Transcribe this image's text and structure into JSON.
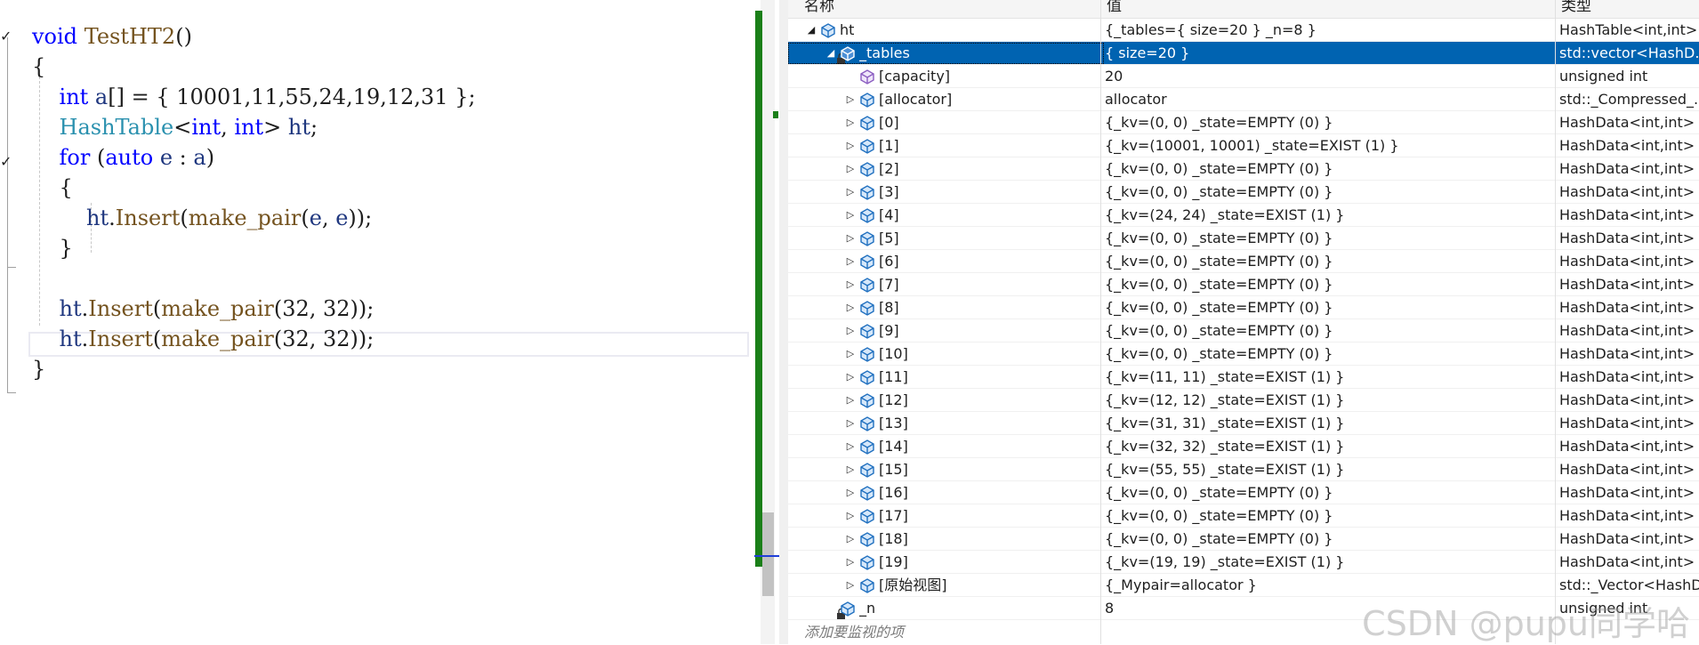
{
  "editor": {
    "lines": [
      {
        "tokens": [
          {
            "t": "void ",
            "c": "kw"
          },
          {
            "t": "TestHT2",
            "c": "fn"
          },
          {
            "t": "()",
            "c": "pl"
          }
        ]
      },
      {
        "tokens": [
          {
            "t": "{",
            "c": "pl"
          }
        ]
      },
      {
        "tokens": [
          {
            "t": "    int ",
            "c": "kw"
          },
          {
            "t": "a",
            "c": "id"
          },
          {
            "t": "[] = { 10001,11,55,24,19,12,31 };",
            "c": "pl"
          }
        ]
      },
      {
        "tokens": [
          {
            "t": "    HashTable",
            "c": "ty"
          },
          {
            "t": "<",
            "c": "pl"
          },
          {
            "t": "int",
            "c": "kw"
          },
          {
            "t": ", ",
            "c": "pl"
          },
          {
            "t": "int",
            "c": "kw"
          },
          {
            "t": "> ",
            "c": "pl"
          },
          {
            "t": "ht",
            "c": "id"
          },
          {
            "t": ";",
            "c": "pl"
          }
        ]
      },
      {
        "tokens": [
          {
            "t": "    for ",
            "c": "kw"
          },
          {
            "t": "(",
            "c": "pl"
          },
          {
            "t": "auto ",
            "c": "kw"
          },
          {
            "t": "e",
            "c": "id"
          },
          {
            "t": " : ",
            "c": "pl"
          },
          {
            "t": "a",
            "c": "id"
          },
          {
            "t": ")",
            "c": "pl"
          }
        ]
      },
      {
        "tokens": [
          {
            "t": "    {",
            "c": "pl"
          }
        ]
      },
      {
        "tokens": [
          {
            "t": "        ht",
            "c": "id"
          },
          {
            "t": ".",
            "c": "pl"
          },
          {
            "t": "Insert",
            "c": "fn"
          },
          {
            "t": "(",
            "c": "pl"
          },
          {
            "t": "make_pair",
            "c": "fn"
          },
          {
            "t": "(",
            "c": "pl"
          },
          {
            "t": "e",
            "c": "id"
          },
          {
            "t": ", ",
            "c": "pl"
          },
          {
            "t": "e",
            "c": "id"
          },
          {
            "t": "));",
            "c": "pl"
          }
        ]
      },
      {
        "tokens": [
          {
            "t": "    }",
            "c": "pl"
          }
        ]
      },
      {
        "tokens": [
          {
            "t": "",
            "c": "pl"
          }
        ]
      },
      {
        "tokens": [
          {
            "t": "    ht",
            "c": "id"
          },
          {
            "t": ".",
            "c": "pl"
          },
          {
            "t": "Insert",
            "c": "fn"
          },
          {
            "t": "(",
            "c": "pl"
          },
          {
            "t": "make_pair",
            "c": "fn"
          },
          {
            "t": "(32, 32));",
            "c": "pl"
          }
        ]
      },
      {
        "tokens": [
          {
            "t": "    ht",
            "c": "id"
          },
          {
            "t": ".",
            "c": "pl"
          },
          {
            "t": "Insert",
            "c": "fn"
          },
          {
            "t": "(",
            "c": "pl"
          },
          {
            "t": "make_pair",
            "c": "fn"
          },
          {
            "t": "(32, 32));",
            "c": "pl"
          }
        ]
      },
      {
        "tokens": [
          {
            "t": "}",
            "c": "pl"
          }
        ]
      }
    ],
    "fold_marks": [
      "✓",
      "✓"
    ]
  },
  "watch": {
    "headers": {
      "name": "名称",
      "value": "值",
      "type": "类型"
    },
    "rows": [
      {
        "expander": "expanded",
        "icon": "object",
        "name": "ht",
        "value": "{_tables={ size=20 } _n=8 }",
        "type": "HashTable<int,int>"
      },
      {
        "expander": "expanded",
        "icon": "object",
        "lock": true,
        "name": "_tables",
        "value": "{ size=20 }",
        "type": "std::vector<HashD...",
        "selected": true
      },
      {
        "expander": "none",
        "icon": "field",
        "name": "[capacity]",
        "value": "20",
        "type": "unsigned int"
      },
      {
        "expander": "collapsed",
        "icon": "object",
        "name": "[allocator]",
        "value": "allocator",
        "type": "std::_Compressed_..."
      },
      {
        "expander": "collapsed",
        "icon": "object",
        "name": "[0]",
        "value": "{_kv=(0, 0) _state=EMPTY (0) }",
        "type": "HashData<int,int>"
      },
      {
        "expander": "collapsed",
        "icon": "object",
        "name": "[1]",
        "value": "{_kv=(10001, 10001) _state=EXIST (1) }",
        "type": "HashData<int,int>"
      },
      {
        "expander": "collapsed",
        "icon": "object",
        "name": "[2]",
        "value": "{_kv=(0, 0) _state=EMPTY (0) }",
        "type": "HashData<int,int>"
      },
      {
        "expander": "collapsed",
        "icon": "object",
        "name": "[3]",
        "value": "{_kv=(0, 0) _state=EMPTY (0) }",
        "type": "HashData<int,int>"
      },
      {
        "expander": "collapsed",
        "icon": "object",
        "name": "[4]",
        "value": "{_kv=(24, 24) _state=EXIST (1) }",
        "type": "HashData<int,int>"
      },
      {
        "expander": "collapsed",
        "icon": "object",
        "name": "[5]",
        "value": "{_kv=(0, 0) _state=EMPTY (0) }",
        "type": "HashData<int,int>"
      },
      {
        "expander": "collapsed",
        "icon": "object",
        "name": "[6]",
        "value": "{_kv=(0, 0) _state=EMPTY (0) }",
        "type": "HashData<int,int>"
      },
      {
        "expander": "collapsed",
        "icon": "object",
        "name": "[7]",
        "value": "{_kv=(0, 0) _state=EMPTY (0) }",
        "type": "HashData<int,int>"
      },
      {
        "expander": "collapsed",
        "icon": "object",
        "name": "[8]",
        "value": "{_kv=(0, 0) _state=EMPTY (0) }",
        "type": "HashData<int,int>"
      },
      {
        "expander": "collapsed",
        "icon": "object",
        "name": "[9]",
        "value": "{_kv=(0, 0) _state=EMPTY (0) }",
        "type": "HashData<int,int>"
      },
      {
        "expander": "collapsed",
        "icon": "object",
        "name": "[10]",
        "value": "{_kv=(0, 0) _state=EMPTY (0) }",
        "type": "HashData<int,int>"
      },
      {
        "expander": "collapsed",
        "icon": "object",
        "name": "[11]",
        "value": "{_kv=(11, 11) _state=EXIST (1) }",
        "type": "HashData<int,int>"
      },
      {
        "expander": "collapsed",
        "icon": "object",
        "name": "[12]",
        "value": "{_kv=(12, 12) _state=EXIST (1) }",
        "type": "HashData<int,int>"
      },
      {
        "expander": "collapsed",
        "icon": "object",
        "name": "[13]",
        "value": "{_kv=(31, 31) _state=EXIST (1) }",
        "type": "HashData<int,int>"
      },
      {
        "expander": "collapsed",
        "icon": "object",
        "name": "[14]",
        "value": "{_kv=(32, 32) _state=EXIST (1) }",
        "type": "HashData<int,int>"
      },
      {
        "expander": "collapsed",
        "icon": "object",
        "name": "[15]",
        "value": "{_kv=(55, 55) _state=EXIST (1) }",
        "type": "HashData<int,int>"
      },
      {
        "expander": "collapsed",
        "icon": "object",
        "name": "[16]",
        "value": "{_kv=(0, 0) _state=EMPTY (0) }",
        "type": "HashData<int,int>"
      },
      {
        "expander": "collapsed",
        "icon": "object",
        "name": "[17]",
        "value": "{_kv=(0, 0) _state=EMPTY (0) }",
        "type": "HashData<int,int>"
      },
      {
        "expander": "collapsed",
        "icon": "object",
        "name": "[18]",
        "value": "{_kv=(0, 0) _state=EMPTY (0) }",
        "type": "HashData<int,int>"
      },
      {
        "expander": "collapsed",
        "icon": "object",
        "name": "[19]",
        "value": "{_kv=(19, 19) _state=EXIST (1) }",
        "type": "HashData<int,int>"
      },
      {
        "expander": "collapsed",
        "icon": "object",
        "name": "[原始视图]",
        "value": "{_Mypair=allocator }",
        "type": "std::_Vector<HashD..."
      },
      {
        "expander": "none",
        "icon": "object",
        "lock": true,
        "name": "_n",
        "value": "8",
        "type": "unsigned int"
      }
    ],
    "add_item_placeholder": "添加要监视的项"
  },
  "watermark": "CSDN @pupu同学哈",
  "colors": {
    "selection": "#0063b1",
    "change_bar": "#1a7f18",
    "keyword": "#0000ff",
    "type": "#2b91af",
    "function": "#74531f",
    "identifier": "#1f377f"
  }
}
